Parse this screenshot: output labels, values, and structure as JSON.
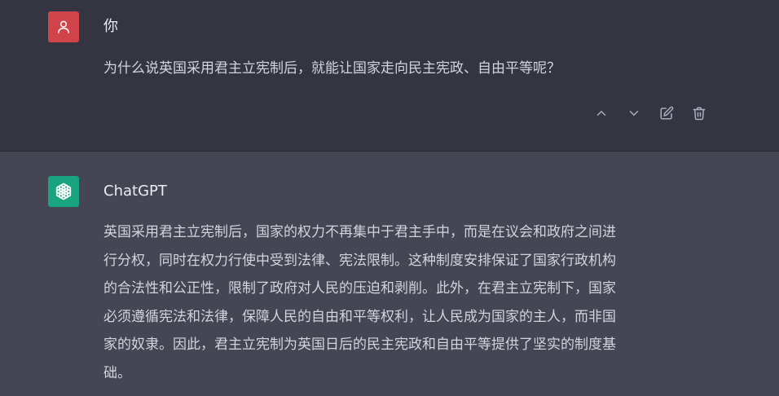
{
  "user_message": {
    "author": "你",
    "text": "为什么说英国采用君主立宪制后，就能让国家走向民主宪政、自由平等呢？",
    "avatar_color": "#d0434b",
    "actions": [
      "chevron-up-icon",
      "chevron-down-icon",
      "edit-icon",
      "trash-icon"
    ]
  },
  "assistant_message": {
    "author": "ChatGPT",
    "avatar_color": "#19a47f",
    "lines": [
      "英国采用君主立宪制后，国家的权力不再集中于君主手中，而是在议会和政府之间进",
      "行分权，同时在权力行使中受到法律、宪法限制。这种制度安排保证了国家行政机构",
      "的合法性和公正性，限制了政府对人民的压迫和剥削。此外，在君主立宪制下，国家",
      "必须遵循宪法和法律，保障人民的自由和平等权利，让人民成为国家的主人，而非国",
      "家的奴隶。因此，君主立宪制为英国日后的民主宪政和自由平等提供了坚实的制度基",
      "础。"
    ]
  },
  "colors": {
    "user_bg": "#343541",
    "assistant_bg": "#444654",
    "text": "#d1d5db",
    "author_text": "#ececf1",
    "icon": "#acacbe"
  }
}
